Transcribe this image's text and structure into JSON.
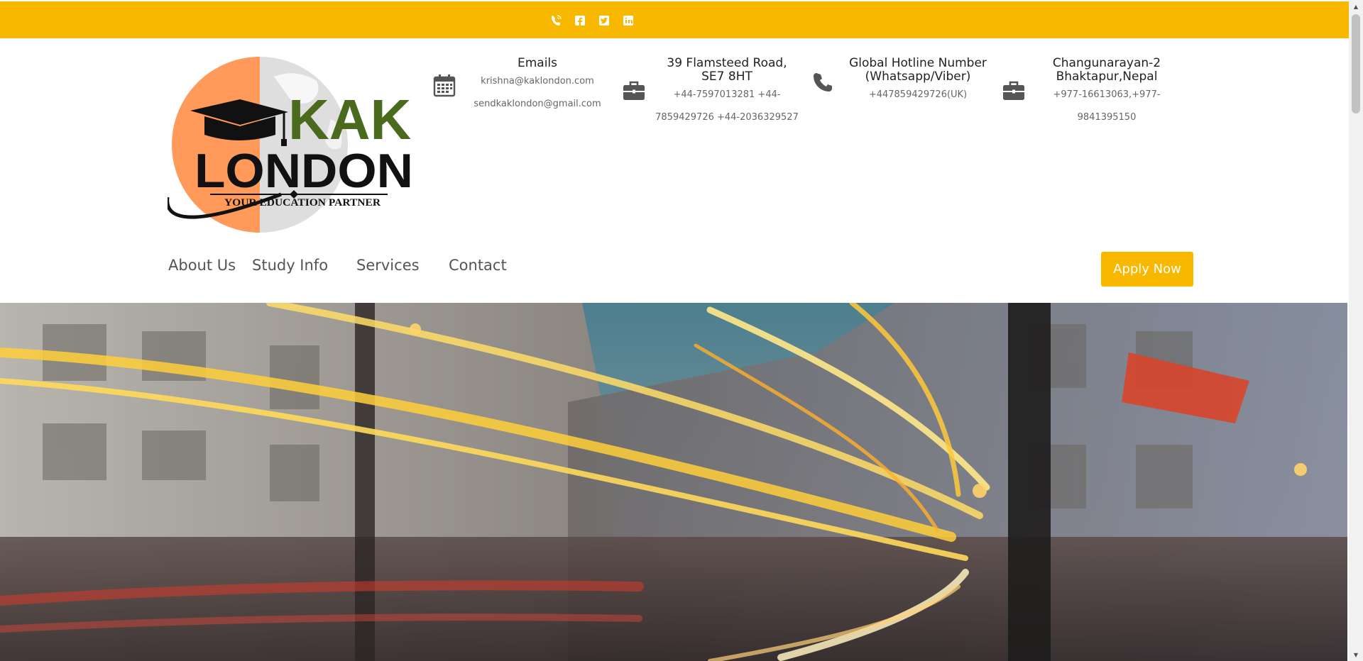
{
  "colors": {
    "brand_yellow": "#f9b800",
    "logo_orange": "#ff9a5a",
    "logo_green": "#4a6a1d",
    "text_dark": "#222222",
    "text_muted": "#666666",
    "nav_text": "#555555"
  },
  "topbar": {
    "social_icons": [
      "viber-icon",
      "facebook-icon",
      "twitter-icon",
      "linkedin-icon"
    ]
  },
  "logo": {
    "brand_top": "KAK",
    "brand_bottom": "LONDON",
    "tagline": "YOUR EDUCATION PARTNER"
  },
  "contacts": [
    {
      "icon": "calendar-icon",
      "title": "Emails",
      "lines": [
        "krishna@kaklondon.com",
        "sendkaklondon@gmail.com"
      ]
    },
    {
      "icon": "briefcase-icon",
      "title_lines": [
        "39 Flamsteed Road,",
        "SE7 8HT"
      ],
      "lines": [
        "+44-7597013281 +44-",
        "7859429726 +44-2036329527"
      ]
    },
    {
      "icon": "phone-icon",
      "title_lines": [
        "Global Hotline Number",
        "(Whatsapp/Viber)"
      ],
      "lines": [
        "+447859429726(UK)"
      ]
    },
    {
      "icon": "briefcase-icon",
      "title_lines": [
        "Changunarayan-2",
        "Bhaktapur,Nepal"
      ],
      "lines": [
        "+977-16613063,+977-",
        "9841395150"
      ]
    }
  ],
  "nav": {
    "items": [
      {
        "label": "About Us"
      },
      {
        "label": "Study Info"
      },
      {
        "label": "Services"
      },
      {
        "label": "Contact"
      }
    ],
    "apply_label": "Apply Now"
  },
  "hero": {
    "image": "london-street-night-light-trails"
  }
}
